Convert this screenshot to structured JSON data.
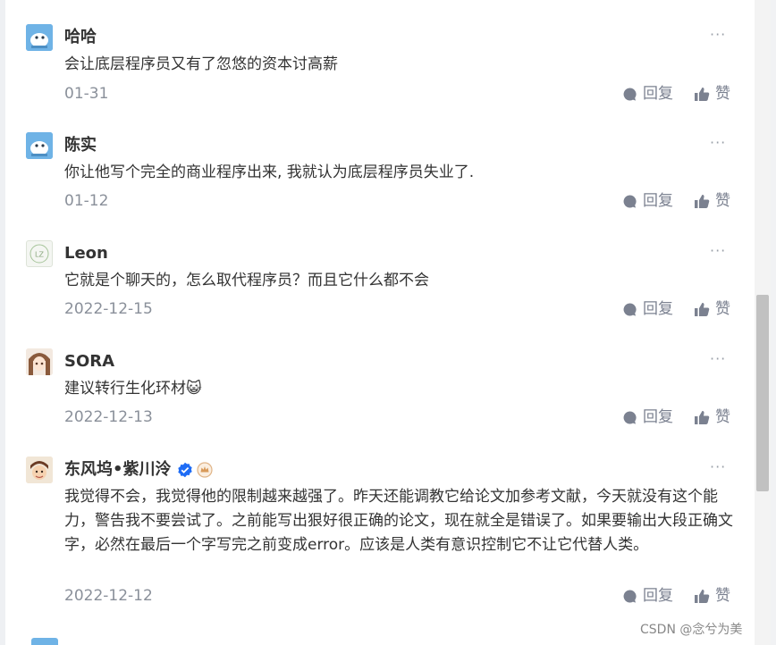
{
  "comments": [
    {
      "user": "哈哈",
      "text": "会让底层程序员又有了忽悠的资本讨高薪",
      "date": "01-31",
      "avatar": "blue-bird-avatar"
    },
    {
      "user": "陈实",
      "text": "你让他写个完全的商业程序出来, 我就认为底层程序员失业了.",
      "date": "01-12",
      "avatar": "blue-bird-avatar"
    },
    {
      "user": "Leon",
      "text": "它就是个聊天的，怎么取代程序员？而且它什么都不会",
      "date": "2022-12-15",
      "avatar": "lz-initials-avatar",
      "avatar_initials": "LZ"
    },
    {
      "user": "SORA",
      "text": "建议转行生化环材😺",
      "date": "2022-12-13",
      "avatar": "anime-girl-avatar"
    },
    {
      "user": "东风坞•紫川泠",
      "text": "我觉得不会，我觉得他的限制越来越强了。昨天还能调教它给论文加参考文献，今天就没有这个能力，警告我不要尝试了。之前能写出狠好很正确的论文，现在就全是错误了。如果要输出大段正确文字，必然在最后一个字写完之前变成error。应该是人类有意识控制它不让它代替人类。",
      "date": "2022-12-12",
      "avatar": "cartoon-boy-avatar",
      "verified": true,
      "crown": true
    }
  ],
  "actions": {
    "reply": "回复",
    "like": "赞",
    "more": "···"
  },
  "watermark": "CSDN @念兮为美",
  "colors": {
    "username": "#333333",
    "meta": "#8a909a",
    "action": "#7b8190",
    "verified": "#1e6cf5",
    "crown": "#d89a5a"
  }
}
